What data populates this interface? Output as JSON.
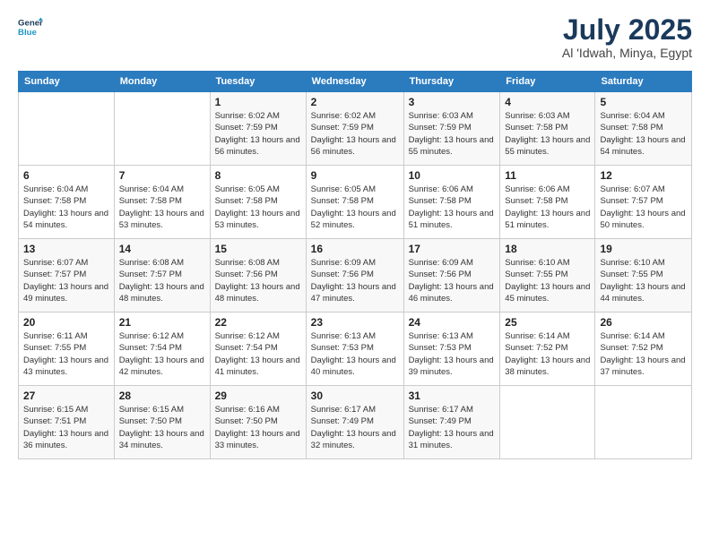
{
  "logo": {
    "line1": "General",
    "line2": "Blue"
  },
  "title": "July 2025",
  "location": "Al 'Idwah, Minya, Egypt",
  "days_header": [
    "Sunday",
    "Monday",
    "Tuesday",
    "Wednesday",
    "Thursday",
    "Friday",
    "Saturday"
  ],
  "weeks": [
    [
      {
        "day": "",
        "info": ""
      },
      {
        "day": "",
        "info": ""
      },
      {
        "day": "1",
        "info": "Sunrise: 6:02 AM\nSunset: 7:59 PM\nDaylight: 13 hours and 56 minutes."
      },
      {
        "day": "2",
        "info": "Sunrise: 6:02 AM\nSunset: 7:59 PM\nDaylight: 13 hours and 56 minutes."
      },
      {
        "day": "3",
        "info": "Sunrise: 6:03 AM\nSunset: 7:59 PM\nDaylight: 13 hours and 55 minutes."
      },
      {
        "day": "4",
        "info": "Sunrise: 6:03 AM\nSunset: 7:58 PM\nDaylight: 13 hours and 55 minutes."
      },
      {
        "day": "5",
        "info": "Sunrise: 6:04 AM\nSunset: 7:58 PM\nDaylight: 13 hours and 54 minutes."
      }
    ],
    [
      {
        "day": "6",
        "info": "Sunrise: 6:04 AM\nSunset: 7:58 PM\nDaylight: 13 hours and 54 minutes."
      },
      {
        "day": "7",
        "info": "Sunrise: 6:04 AM\nSunset: 7:58 PM\nDaylight: 13 hours and 53 minutes."
      },
      {
        "day": "8",
        "info": "Sunrise: 6:05 AM\nSunset: 7:58 PM\nDaylight: 13 hours and 53 minutes."
      },
      {
        "day": "9",
        "info": "Sunrise: 6:05 AM\nSunset: 7:58 PM\nDaylight: 13 hours and 52 minutes."
      },
      {
        "day": "10",
        "info": "Sunrise: 6:06 AM\nSunset: 7:58 PM\nDaylight: 13 hours and 51 minutes."
      },
      {
        "day": "11",
        "info": "Sunrise: 6:06 AM\nSunset: 7:58 PM\nDaylight: 13 hours and 51 minutes."
      },
      {
        "day": "12",
        "info": "Sunrise: 6:07 AM\nSunset: 7:57 PM\nDaylight: 13 hours and 50 minutes."
      }
    ],
    [
      {
        "day": "13",
        "info": "Sunrise: 6:07 AM\nSunset: 7:57 PM\nDaylight: 13 hours and 49 minutes."
      },
      {
        "day": "14",
        "info": "Sunrise: 6:08 AM\nSunset: 7:57 PM\nDaylight: 13 hours and 48 minutes."
      },
      {
        "day": "15",
        "info": "Sunrise: 6:08 AM\nSunset: 7:56 PM\nDaylight: 13 hours and 48 minutes."
      },
      {
        "day": "16",
        "info": "Sunrise: 6:09 AM\nSunset: 7:56 PM\nDaylight: 13 hours and 47 minutes."
      },
      {
        "day": "17",
        "info": "Sunrise: 6:09 AM\nSunset: 7:56 PM\nDaylight: 13 hours and 46 minutes."
      },
      {
        "day": "18",
        "info": "Sunrise: 6:10 AM\nSunset: 7:55 PM\nDaylight: 13 hours and 45 minutes."
      },
      {
        "day": "19",
        "info": "Sunrise: 6:10 AM\nSunset: 7:55 PM\nDaylight: 13 hours and 44 minutes."
      }
    ],
    [
      {
        "day": "20",
        "info": "Sunrise: 6:11 AM\nSunset: 7:55 PM\nDaylight: 13 hours and 43 minutes."
      },
      {
        "day": "21",
        "info": "Sunrise: 6:12 AM\nSunset: 7:54 PM\nDaylight: 13 hours and 42 minutes."
      },
      {
        "day": "22",
        "info": "Sunrise: 6:12 AM\nSunset: 7:54 PM\nDaylight: 13 hours and 41 minutes."
      },
      {
        "day": "23",
        "info": "Sunrise: 6:13 AM\nSunset: 7:53 PM\nDaylight: 13 hours and 40 minutes."
      },
      {
        "day": "24",
        "info": "Sunrise: 6:13 AM\nSunset: 7:53 PM\nDaylight: 13 hours and 39 minutes."
      },
      {
        "day": "25",
        "info": "Sunrise: 6:14 AM\nSunset: 7:52 PM\nDaylight: 13 hours and 38 minutes."
      },
      {
        "day": "26",
        "info": "Sunrise: 6:14 AM\nSunset: 7:52 PM\nDaylight: 13 hours and 37 minutes."
      }
    ],
    [
      {
        "day": "27",
        "info": "Sunrise: 6:15 AM\nSunset: 7:51 PM\nDaylight: 13 hours and 36 minutes."
      },
      {
        "day": "28",
        "info": "Sunrise: 6:15 AM\nSunset: 7:50 PM\nDaylight: 13 hours and 34 minutes."
      },
      {
        "day": "29",
        "info": "Sunrise: 6:16 AM\nSunset: 7:50 PM\nDaylight: 13 hours and 33 minutes."
      },
      {
        "day": "30",
        "info": "Sunrise: 6:17 AM\nSunset: 7:49 PM\nDaylight: 13 hours and 32 minutes."
      },
      {
        "day": "31",
        "info": "Sunrise: 6:17 AM\nSunset: 7:49 PM\nDaylight: 13 hours and 31 minutes."
      },
      {
        "day": "",
        "info": ""
      },
      {
        "day": "",
        "info": ""
      }
    ]
  ]
}
